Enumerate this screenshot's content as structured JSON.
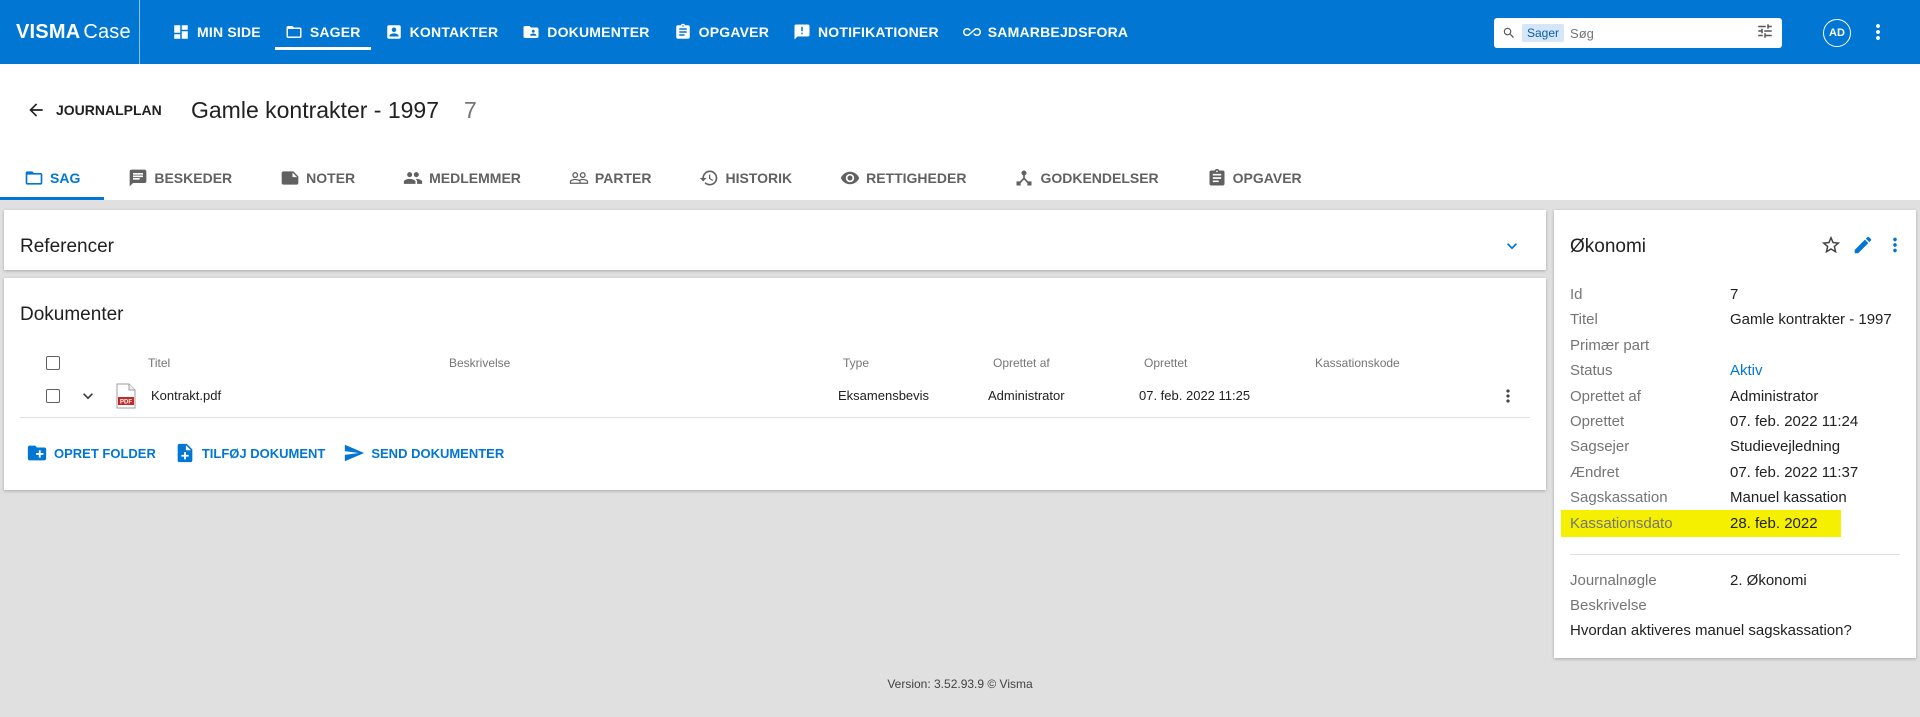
{
  "app": {
    "logo_bold": "VISMA",
    "logo_light": "Case"
  },
  "nav": [
    {
      "label": "MIN SIDE",
      "icon": "dashboard-icon"
    },
    {
      "label": "SAGER",
      "icon": "folder-icon"
    },
    {
      "label": "KONTAKTER",
      "icon": "contact-icon"
    },
    {
      "label": "DOKUMENTER",
      "icon": "documents-icon"
    },
    {
      "label": "OPGAVER",
      "icon": "clipboard-icon"
    },
    {
      "label": "NOTIFIKATIONER",
      "icon": "notification-icon"
    },
    {
      "label": "SAMARBEJDSFORA",
      "icon": "infinity-icon"
    }
  ],
  "search": {
    "scope": "Sager",
    "placeholder": "Søg"
  },
  "user": {
    "initials": "AD"
  },
  "header": {
    "back_label": "JOURNALPLAN",
    "title": "Gamle kontrakter - 1997",
    "count": "7"
  },
  "tabs": [
    {
      "label": "SAG"
    },
    {
      "label": "BESKEDER"
    },
    {
      "label": "NOTER"
    },
    {
      "label": "MEDLEMMER"
    },
    {
      "label": "PARTER"
    },
    {
      "label": "HISTORIK"
    },
    {
      "label": "RETTIGHEDER"
    },
    {
      "label": "GODKENDELSER"
    },
    {
      "label": "OPGAVER"
    }
  ],
  "references": {
    "title": "Referencer"
  },
  "documents": {
    "title": "Dokumenter",
    "columns": [
      "Titel",
      "Beskrivelse",
      "Type",
      "Oprettet af",
      "Oprettet",
      "Kassationskode"
    ],
    "rows": [
      {
        "title": "Kontrakt.pdf",
        "description": "",
        "type": "Eksamensbevis",
        "created_by": "Administrator",
        "created": "07. feb. 2022 11:25",
        "code": ""
      }
    ],
    "actions": [
      "OPRET FOLDER",
      "TILFØJ DOKUMENT",
      "SEND DOKUMENTER"
    ]
  },
  "economy": {
    "title": "Økonomi",
    "fields": [
      {
        "key": "Id",
        "value": "7"
      },
      {
        "key": "Titel",
        "value": "Gamle kontrakter - 1997"
      },
      {
        "key": "Primær part",
        "value": ""
      },
      {
        "key": "Status",
        "value": "Aktiv"
      },
      {
        "key": "Oprettet af",
        "value": "Administrator"
      },
      {
        "key": "Oprettet",
        "value": "07. feb. 2022 11:24"
      },
      {
        "key": "Sagsejer",
        "value": "Studievejledning"
      },
      {
        "key": "Ændret",
        "value": "07. feb. 2022 11:37"
      },
      {
        "key": "Sagskassation",
        "value": "Manuel kassation"
      },
      {
        "key": "Kassationsdato",
        "value": "28. feb. 2022"
      }
    ],
    "extra": [
      {
        "key": "Journalnøgle",
        "value": "2. Økonomi"
      },
      {
        "key": "Beskrivelse",
        "value": ""
      }
    ],
    "question": "Hvordan aktiveres manuel sagskassation?",
    "highlight_color": "#f5ef00"
  },
  "footer": {
    "version": "Version: 3.52.93.9  © Visma"
  },
  "colors": {
    "brand": "#0176d3",
    "background": "#e0e0e0"
  }
}
